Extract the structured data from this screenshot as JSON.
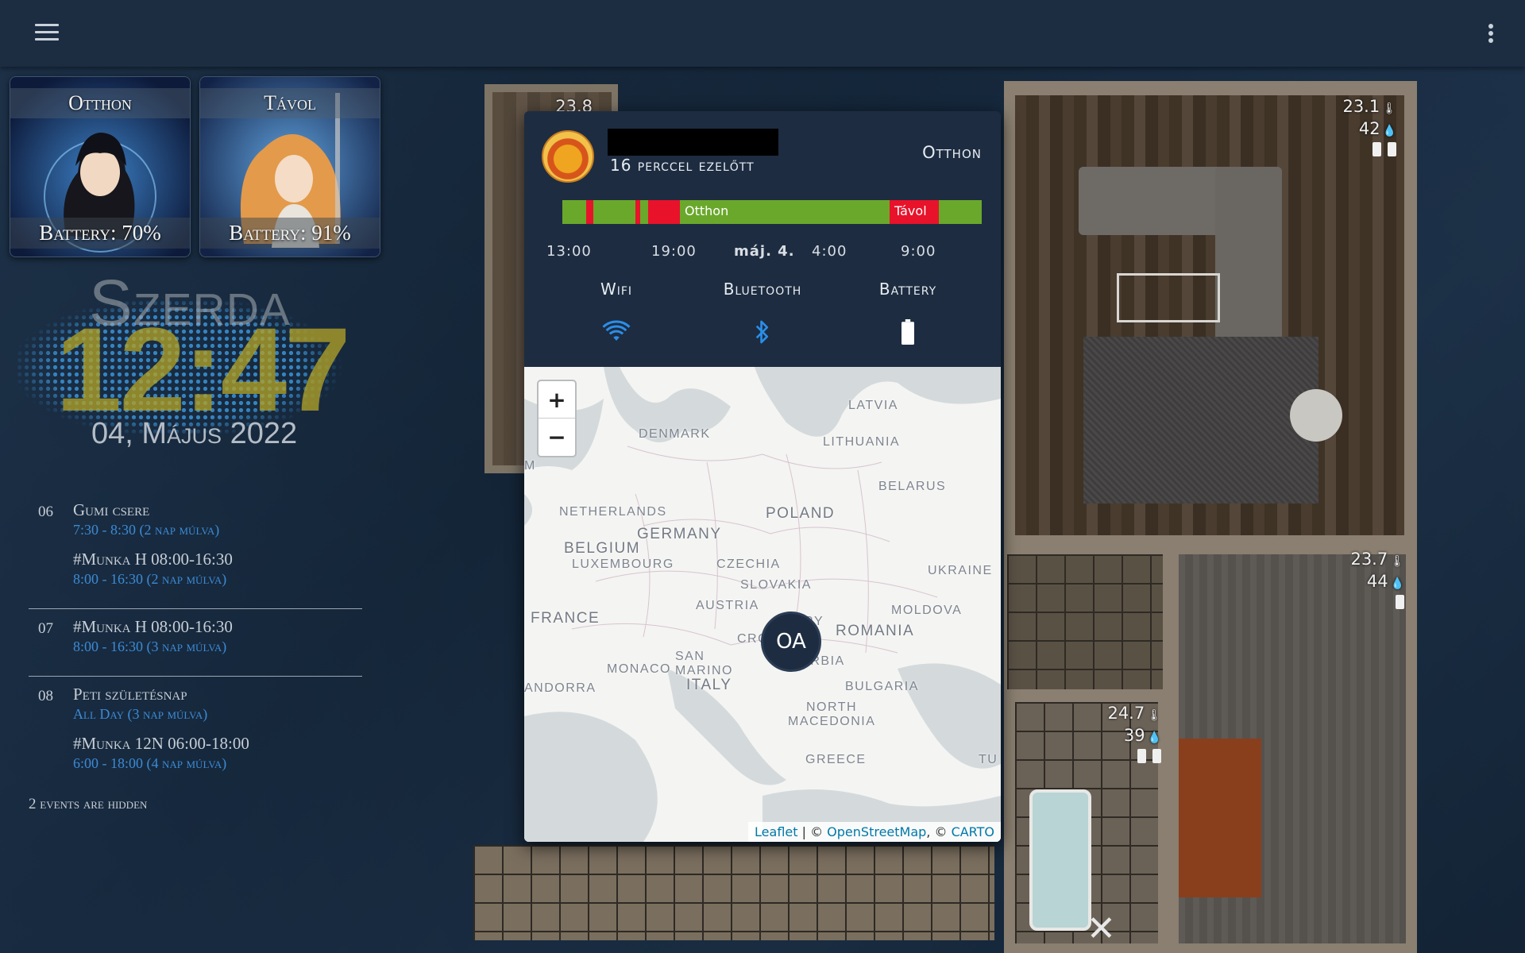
{
  "persons": [
    {
      "name": "Otthon",
      "battery": "Battery: 70%"
    },
    {
      "name": "Távol",
      "battery": "Battery: 91%"
    }
  ],
  "clock": {
    "day": "Szerda",
    "time": "12:47",
    "date": "04, Május 2022"
  },
  "events": [
    {
      "day": "06",
      "items": [
        {
          "title": "Gumi csere",
          "when": "7:30 - 8:30 (2 nap múlva)"
        },
        {
          "title": "#Munka H 08:00-16:30",
          "when": "8:00 - 16:30 (2 nap múlva)"
        }
      ]
    },
    {
      "day": "07",
      "items": [
        {
          "title": "#Munka H 08:00-16:30",
          "when": "8:00 - 16:30 (3 nap múlva)"
        }
      ]
    },
    {
      "day": "08",
      "items": [
        {
          "title": "Peti születésnap",
          "when": "All Day (3 nap múlva)"
        },
        {
          "title": "#Munka 12N 06:00-18:00",
          "when": "6:00 - 18:00 (4 nap múlva)"
        }
      ]
    }
  ],
  "events_hidden": "2 events are hidden",
  "sensors": [
    {
      "temp": "23.1",
      "hum": "42"
    },
    {
      "temp": "23.7",
      "hum": "44"
    },
    {
      "temp": "24.7",
      "hum": "39"
    },
    {
      "temp": "23.8",
      "hum": ""
    }
  ],
  "popup": {
    "last_changed": "16 perccel ezelőtt",
    "state": "Otthon",
    "timeline": {
      "label_home": "Otthon",
      "label_away": "Távol",
      "ticks": [
        "13:00",
        "19:00",
        "máj. 4.",
        "4:00",
        "9:00"
      ],
      "colors": {
        "home": "#6aa82c",
        "away": "#e8122a"
      }
    },
    "attributes": [
      {
        "label": "Wifi",
        "icon": "wifi-icon"
      },
      {
        "label": "Bluetooth",
        "icon": "bluetooth-icon"
      },
      {
        "label": "Battery",
        "icon": "battery-icon"
      }
    ],
    "map": {
      "zoom_in": "+",
      "zoom_out": "−",
      "marker": "OA",
      "attribution": {
        "leaflet": "Leaflet",
        "sep1": " | © ",
        "osm": "OpenStreetMap",
        "sep2": ", © ",
        "carto": "CARTO"
      },
      "countries": [
        "Latvia",
        "Denmark",
        "Lithuania",
        "Belarus",
        "Netherlands",
        "Poland",
        "Belgium",
        "Germany",
        "Luxembourg",
        "Czechia",
        "Ukraine",
        "Slovakia",
        "Austria",
        "Moldova",
        "France",
        "Romania",
        "Cro",
        "Serbia",
        "Monaco",
        "San Marino",
        "Italy",
        "Andorra",
        "Bulgaria",
        "North Macedonia",
        "Greece",
        "Tu",
        "ary",
        "M"
      ]
    }
  }
}
